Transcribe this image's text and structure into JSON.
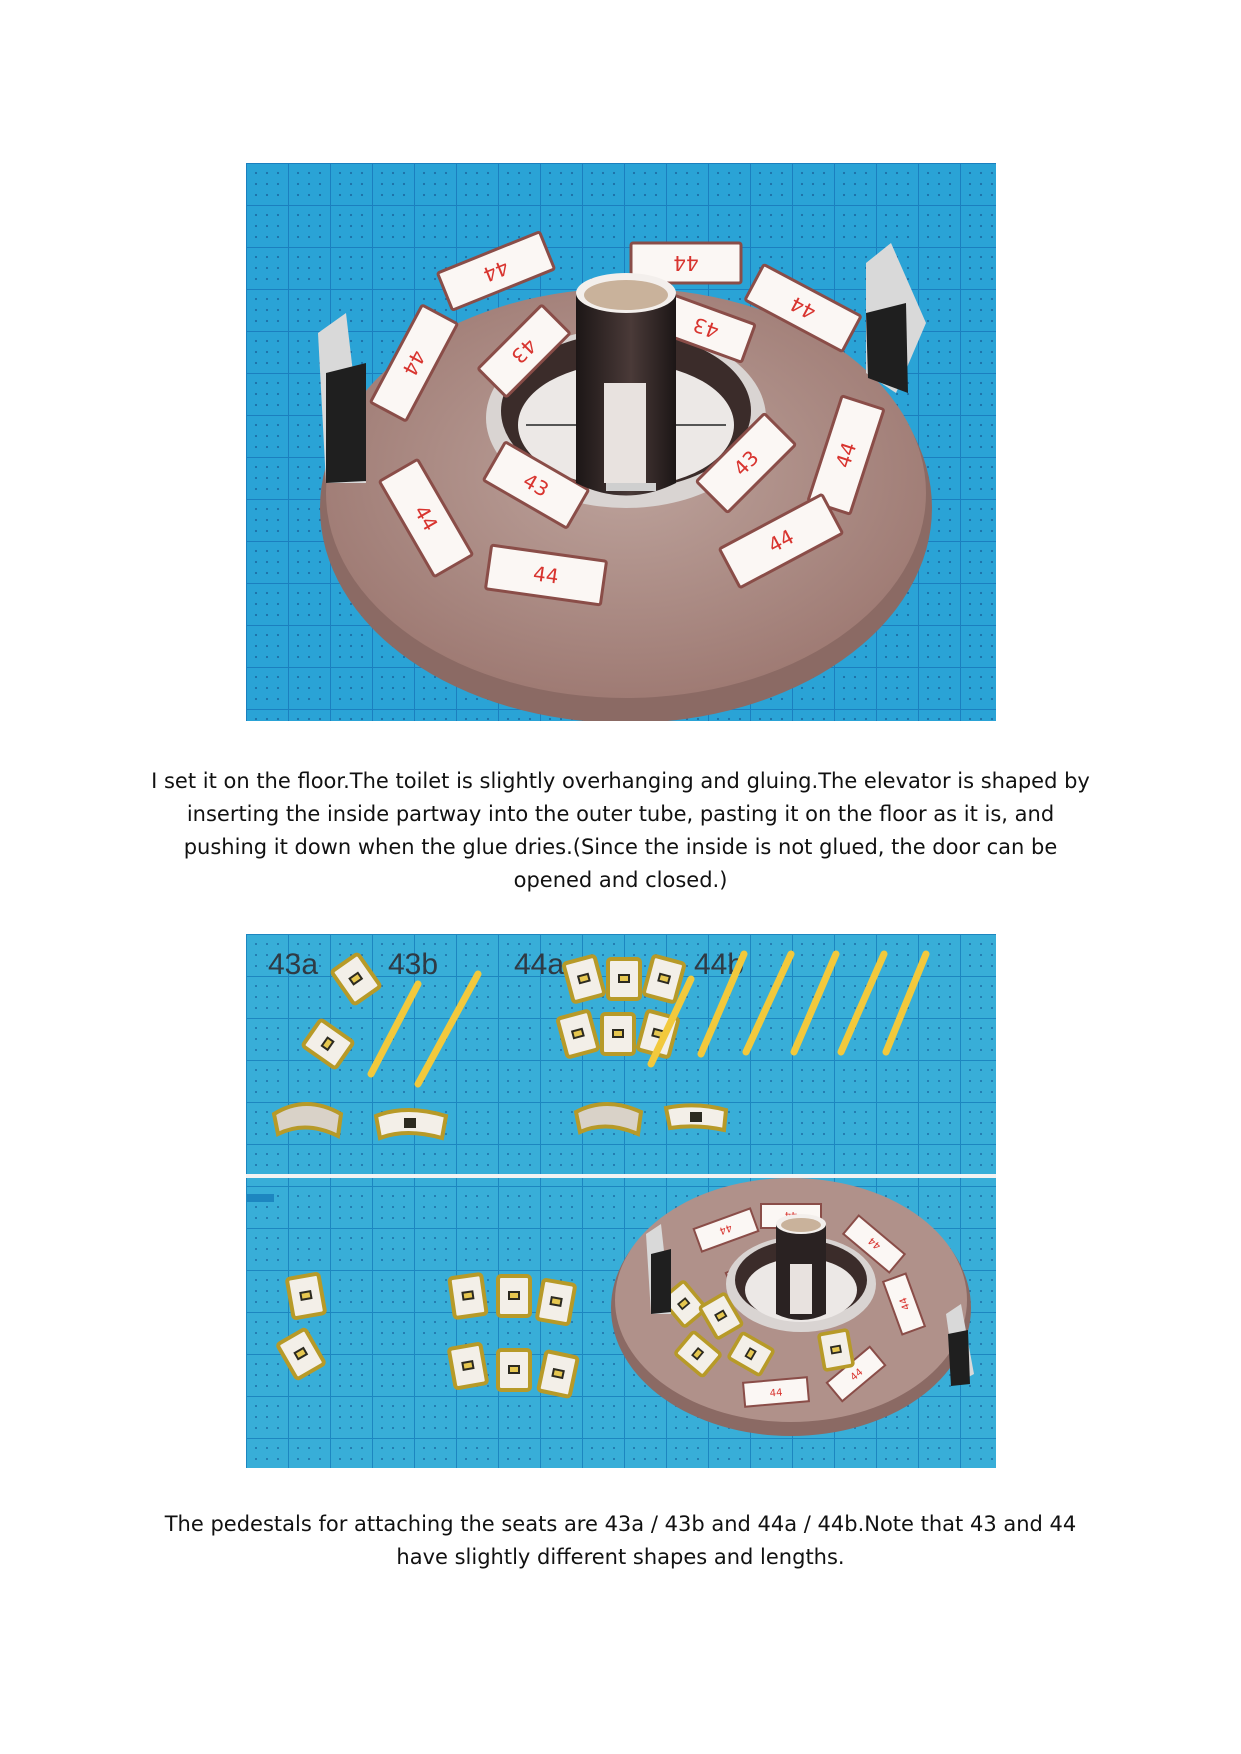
{
  "photo1": {
    "seat_labels": [
      "44",
      "44",
      "44",
      "43",
      "43",
      "44",
      "44",
      "43",
      "43",
      "44",
      "44",
      "44"
    ]
  },
  "caption1": "I set it on the floor.The toilet is slightly overhanging and gluing.The elevator is shaped by inserting the inside partway into the outer tube, pasting it on the floor as it is, and pushing it down when the glue dries.(Since the inside is not glued, the door can be opened and closed.)",
  "photo2": {
    "part_labels": [
      "43a",
      "43b",
      "44a",
      "44b"
    ],
    "seat_labels": [
      "44",
      "44",
      "44",
      "43",
      "44",
      "44",
      "44",
      "44"
    ]
  },
  "caption2": "The pedestals for attaching the seats are 43a / 43b and 44a / 44b.Note that 43 and 44 have slightly different shapes and lengths.",
  "colors": {
    "cutting_mat": "#2aa3d6",
    "mat_grid": "#1b7fbf",
    "floor_disc": "#a9837c",
    "disc_rim": "#e9e2dd",
    "seat_card": "#fbf7f4",
    "seat_text": "#d8342f",
    "pedestal": "#f0d66a",
    "pedestal_edge": "#b2952a",
    "elevator": "#2a2222"
  }
}
